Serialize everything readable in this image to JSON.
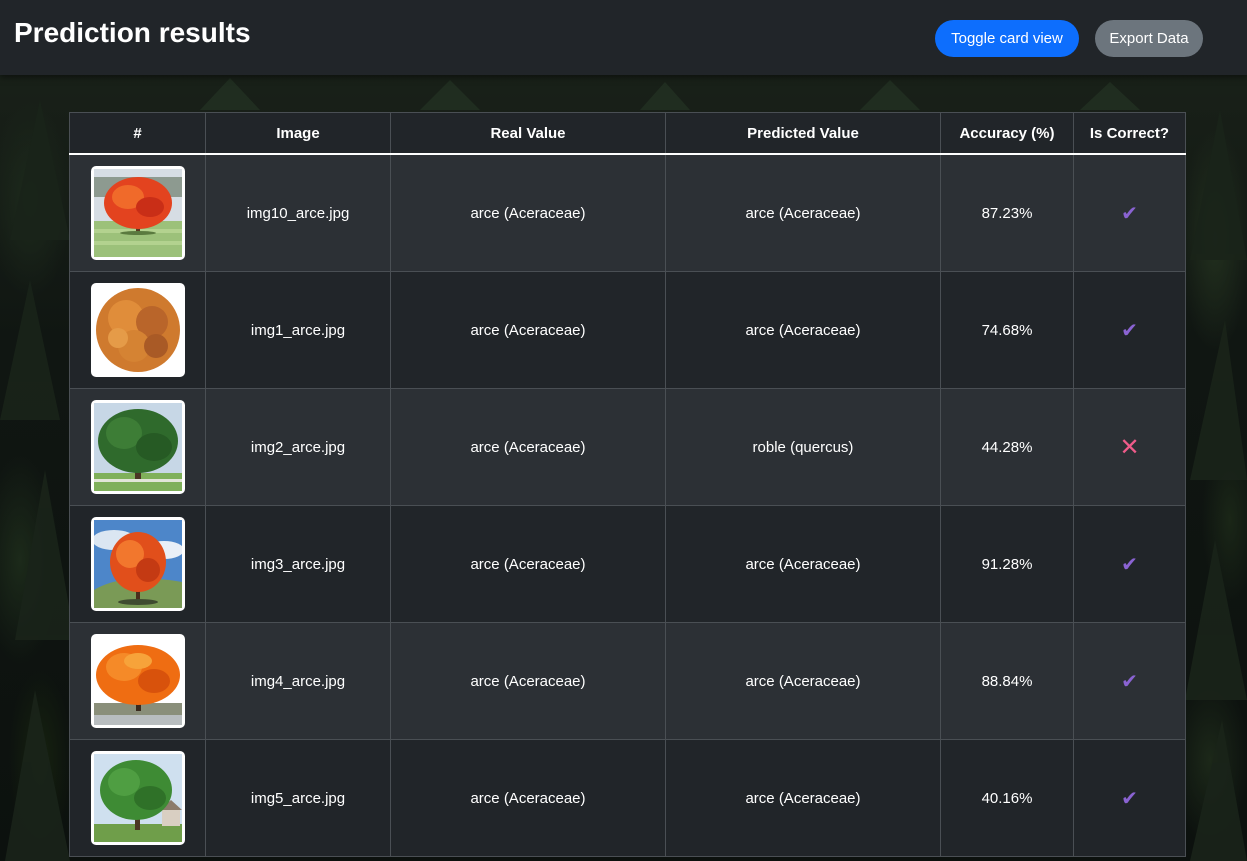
{
  "header": {
    "title": "Prediction results",
    "toggle_label": "Toggle card view",
    "export_label": "Export Data"
  },
  "table": {
    "columns": [
      "#",
      "Image",
      "Real Value",
      "Predicted Value",
      "Accuracy (%)",
      "Is Correct?"
    ],
    "rows": [
      {
        "thumb": "red-maple-lawn",
        "image": "img10_arce.jpg",
        "real": "arce (Aceraceae)",
        "predicted": "arce (Aceraceae)",
        "accuracy": "87.23%",
        "correct": true
      },
      {
        "thumb": "orange-maple-cutout",
        "image": "img1_arce.jpg",
        "real": "arce (Aceraceae)",
        "predicted": "arce (Aceraceae)",
        "accuracy": "74.68%",
        "correct": true
      },
      {
        "thumb": "green-oak-park",
        "image": "img2_arce.jpg",
        "real": "arce (Aceraceae)",
        "predicted": "roble (quercus)",
        "accuracy": "44.28%",
        "correct": false
      },
      {
        "thumb": "red-maple-hill",
        "image": "img3_arce.jpg",
        "real": "arce (Aceraceae)",
        "predicted": "arce (Aceraceae)",
        "accuracy": "91.28%",
        "correct": true
      },
      {
        "thumb": "orange-maple-road",
        "image": "img4_arce.jpg",
        "real": "arce (Aceraceae)",
        "predicted": "arce (Aceraceae)",
        "accuracy": "88.84%",
        "correct": true
      },
      {
        "thumb": "green-maple-house",
        "image": "img5_arce.jpg",
        "real": "arce (Aceraceae)",
        "predicted": "arce (Aceraceae)",
        "accuracy": "40.16%",
        "correct": true
      }
    ]
  },
  "icons": {
    "correct": "check-icon",
    "incorrect": "cross-icon"
  },
  "colors": {
    "primary_button": "#0d6efd",
    "secondary_button": "#6c757d",
    "check": "#8a63d2",
    "cross": "#ef5b8a"
  }
}
